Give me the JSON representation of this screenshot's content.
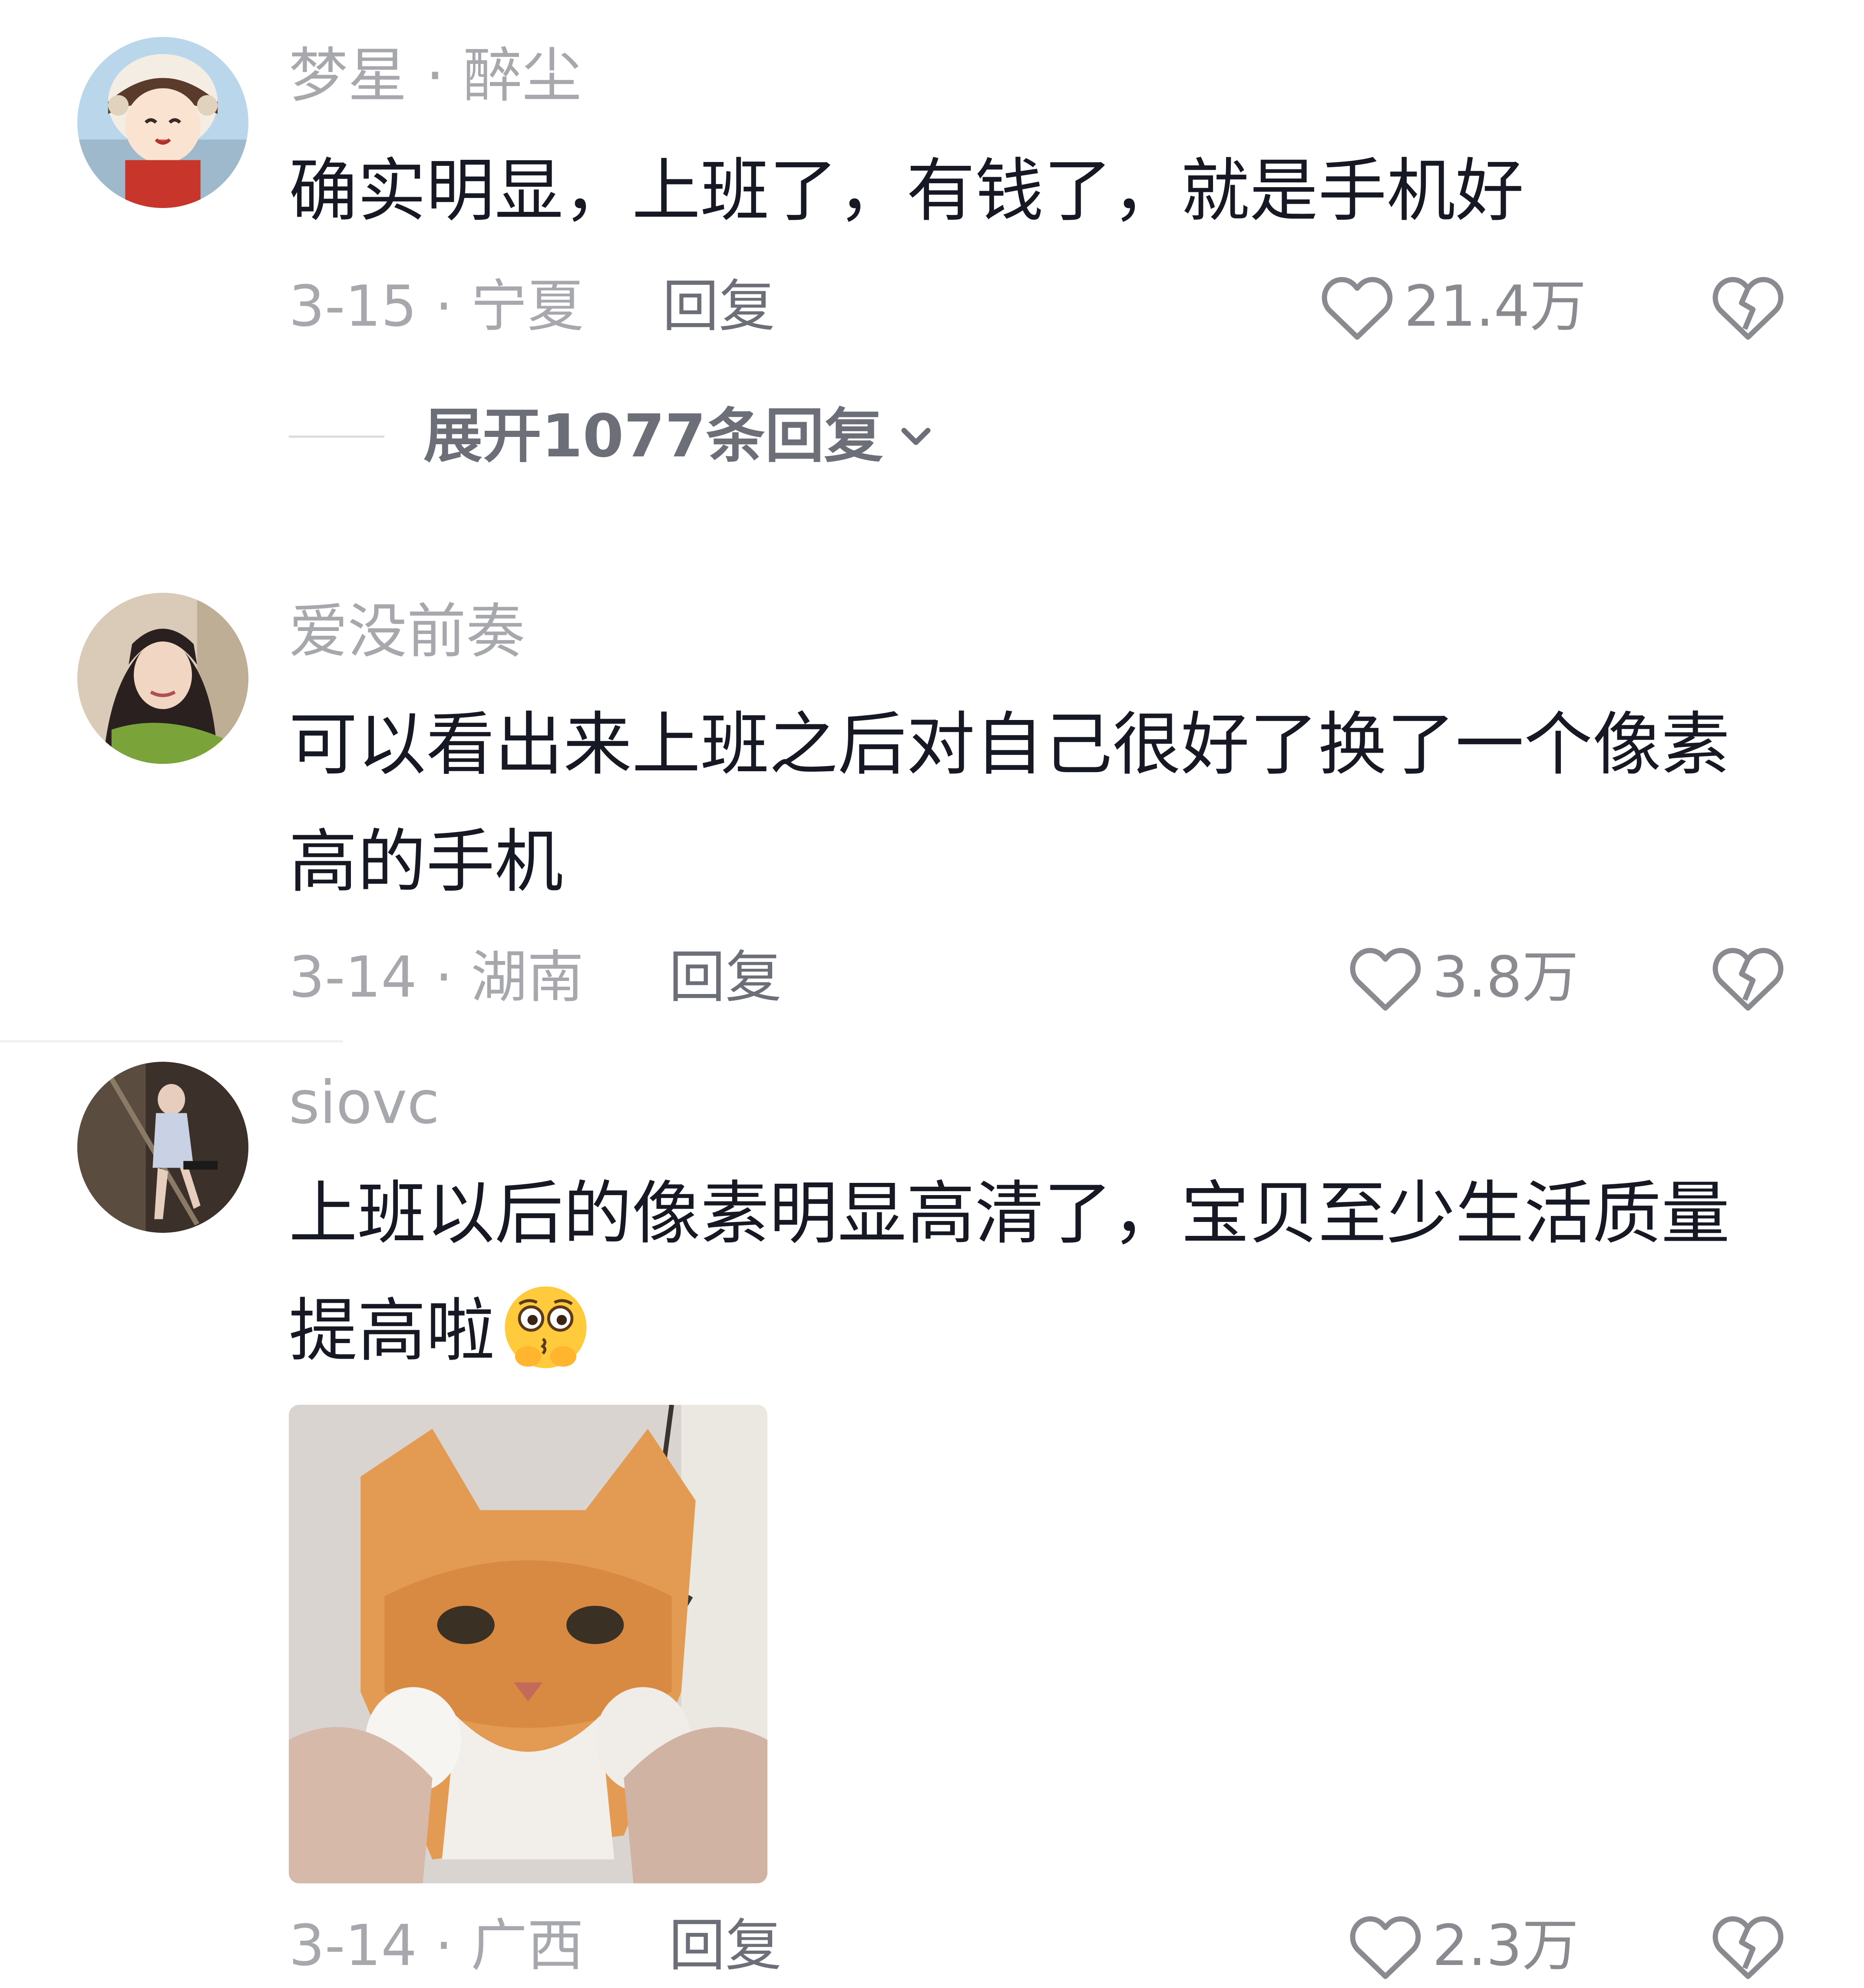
{
  "comments": [
    {
      "username": "梦星 · 醉尘",
      "text": "确实明显，上班了，有钱了，就是手机好",
      "date_location": "3-15 · 宁夏",
      "reply_label": "回复",
      "like_count": "21.4万",
      "expand_label": "展开1077条回复"
    },
    {
      "username": "爱没前奏",
      "text": "可以看出来上班之后对自己很好了换了一个像素高的手机",
      "date_location": "3-14 · 湖南",
      "reply_label": "回复",
      "like_count": "3.8万"
    },
    {
      "username": "siovc",
      "text": "上班以后的像素明显高清了，宝贝至少生活质量提高啦",
      "date_location": "3-14 · 广西",
      "reply_label": "回复",
      "like_count": "2.3万"
    }
  ],
  "icons": {
    "like": "heart-outline-icon",
    "dislike": "broken-heart-icon",
    "expand": "chevron-down-icon",
    "emoji": "pleading-face-emoji"
  },
  "colors": {
    "username": "#a7a8ad",
    "text": "#161823",
    "meta": "#a7a8ad",
    "reply": "#6d6f78",
    "icon": "#8a8b91"
  }
}
